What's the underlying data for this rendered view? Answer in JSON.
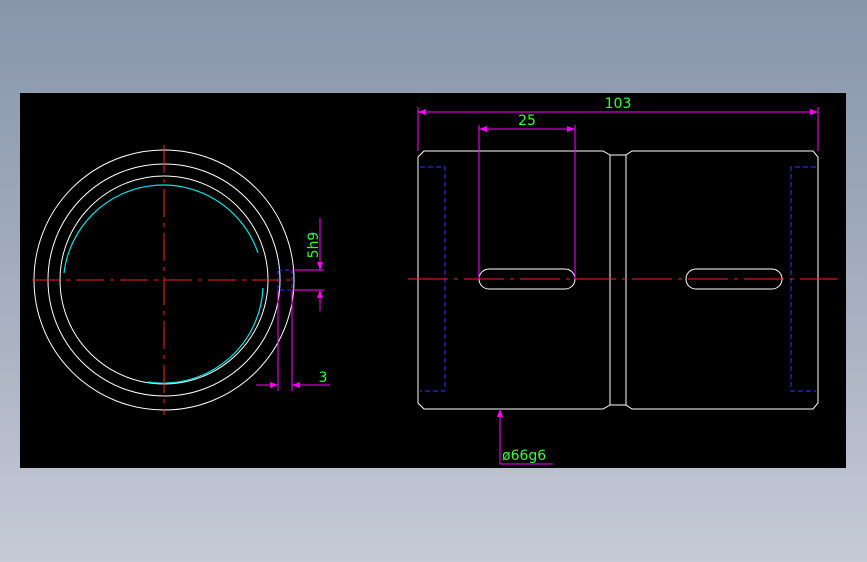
{
  "colors": {
    "background": "#000000",
    "outline": "#ffffff",
    "centerline": "#ff2020",
    "dimension_line": "#ff00ff",
    "dimension_text": "#33ff33",
    "hidden_line": "#3333ff",
    "thread_arc": "#00e5e5"
  },
  "dimensions": {
    "overall_length": "103",
    "slot_length": "25",
    "keyway_width": "5h9",
    "keyway_depth": "3",
    "outer_diameter": "ø66g6"
  }
}
